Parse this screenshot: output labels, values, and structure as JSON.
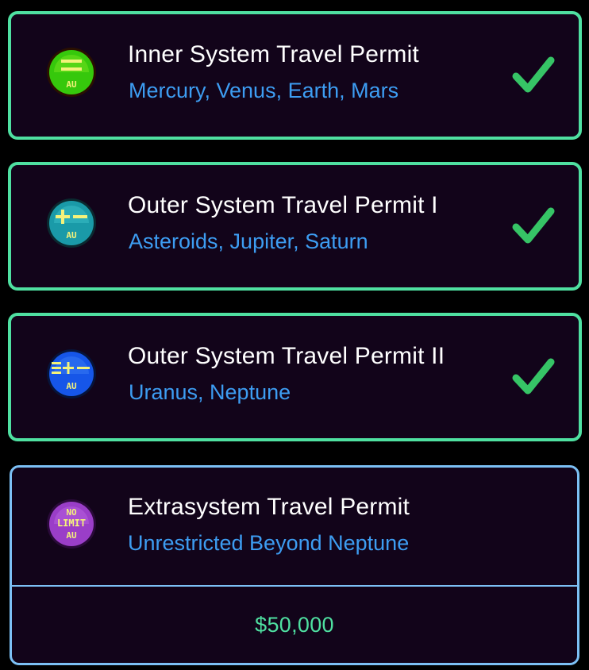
{
  "colors": {
    "owned_border": "#4fe0a1",
    "shop_border": "#7cc0f5",
    "card_bg": "#12041a",
    "title_text": "#ffffff",
    "subtitle_text": "#3d9df2",
    "price_text": "#4fe0a1",
    "checkmark": "#36c466"
  },
  "permits": [
    {
      "title": "Inner System Travel Permit",
      "subtitle": "Mercury, Venus, Earth, Mars",
      "icon": "inner-permit-icon",
      "icon_color": "#36c80c",
      "icon_glyph": "=",
      "icon_label": "AU",
      "owned": true
    },
    {
      "title": "Outer System Travel Permit I",
      "subtitle": "Asteroids, Jupiter, Saturn",
      "icon": "outer-permit-1-icon",
      "icon_color": "#1a9aa8",
      "icon_glyph": "+−",
      "icon_label": "AU",
      "owned": true
    },
    {
      "title": "Outer System Travel Permit II",
      "subtitle": "Uranus, Neptune",
      "icon": "outer-permit-2-icon",
      "icon_color": "#1656e8",
      "icon_glyph": "≡+−",
      "icon_label": "AU",
      "owned": true
    },
    {
      "title": "Extrasystem Travel Permit",
      "subtitle": "Unrestricted Beyond Neptune",
      "icon": "extrasystem-permit-icon",
      "icon_color": "#9a3ec8",
      "icon_glyph": "NO LIMIT",
      "icon_label": "AU",
      "owned": false,
      "price": "$50,000"
    }
  ]
}
